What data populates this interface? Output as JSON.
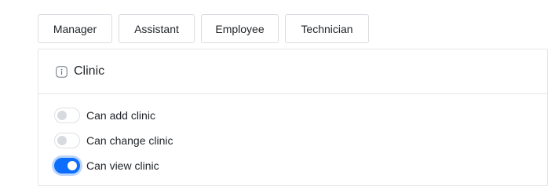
{
  "roles": [
    {
      "label": "Manager"
    },
    {
      "label": "Assistant"
    },
    {
      "label": "Employee"
    },
    {
      "label": "Technician"
    }
  ],
  "section": {
    "icon": "info-icon",
    "title": "Clinic",
    "permissions": [
      {
        "label": "Can add clinic",
        "enabled": false
      },
      {
        "label": "Can change clinic",
        "enabled": false
      },
      {
        "label": "Can view clinic",
        "enabled": true
      }
    ]
  },
  "colors": {
    "accent": "#0d6efd",
    "border": "#e3e6ea",
    "text": "#212529"
  }
}
